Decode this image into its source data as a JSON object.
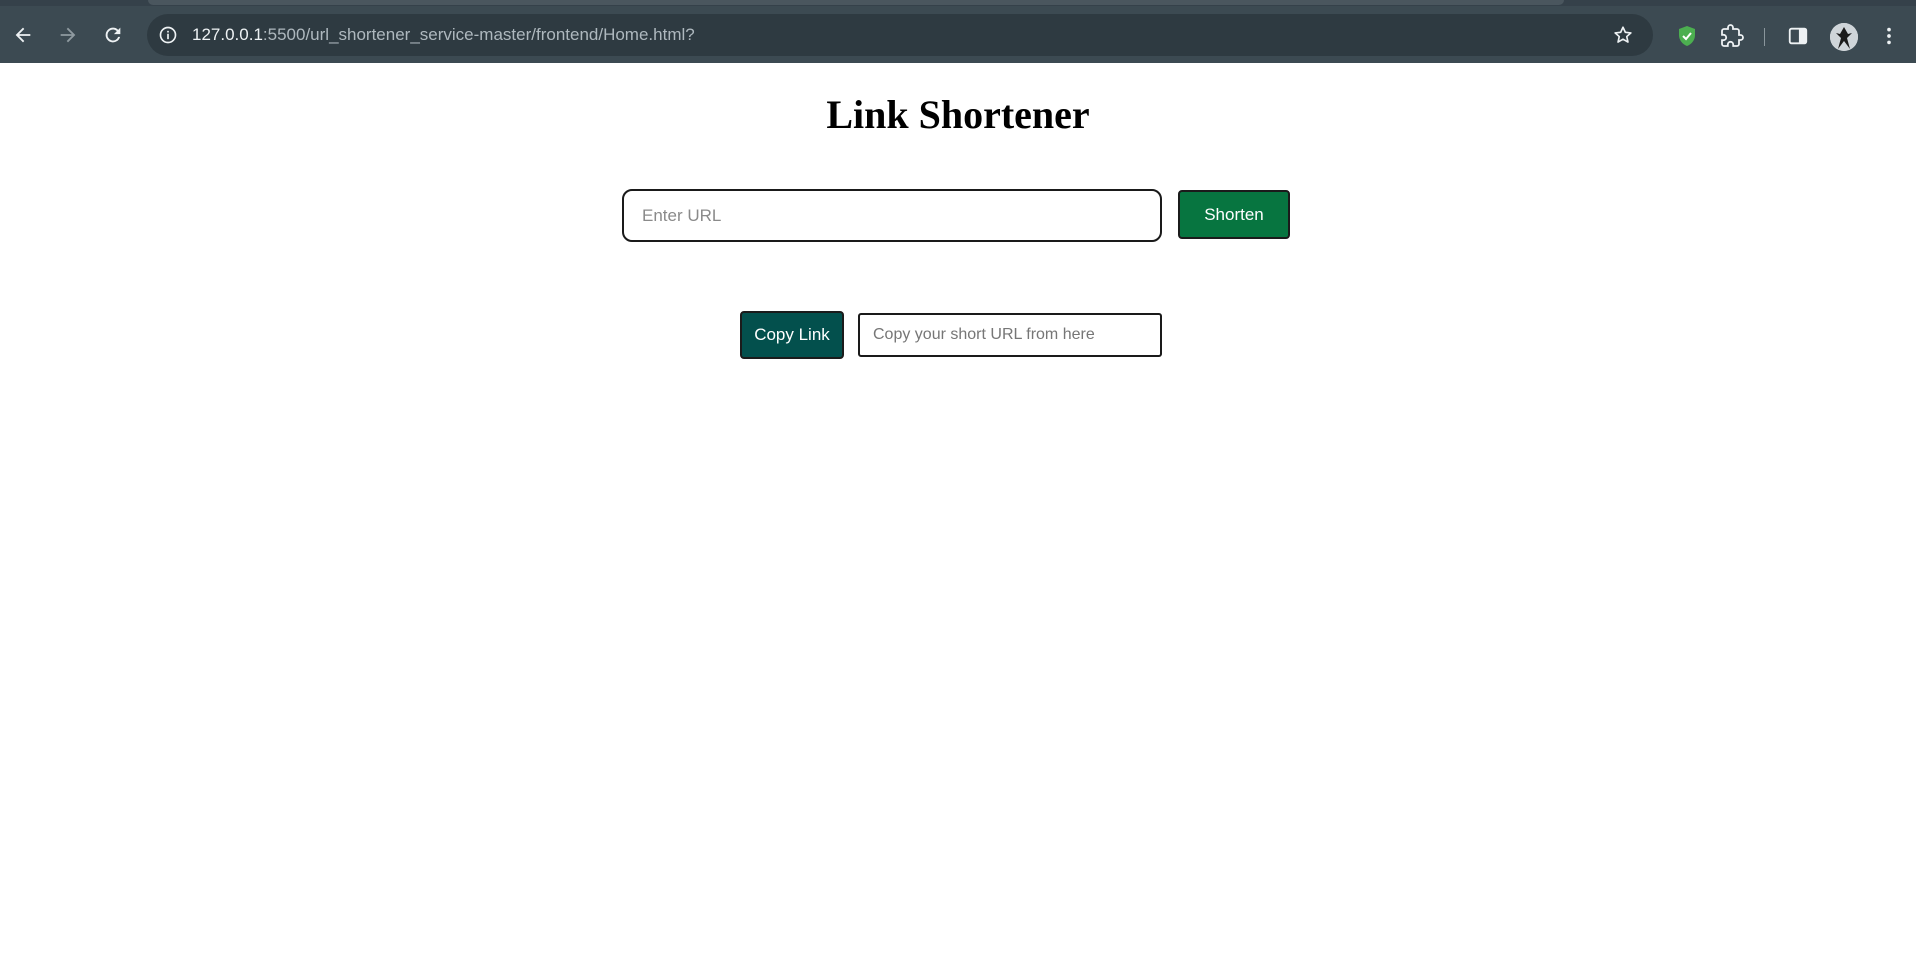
{
  "browser": {
    "url_host": "127.0.0.1",
    "url_rest": ":5500/url_shortener_service-master/frontend/Home.html?",
    "icons": [
      "back-arrow-icon",
      "forward-arrow-icon",
      "reload-icon",
      "site-info-icon",
      "bookmark-star-icon",
      "shield-extension-icon",
      "extensions-puzzle-icon",
      "side-panel-icon",
      "profile-avatar",
      "more-menu-icon"
    ],
    "colors": {
      "toolbar": "#3c4a52",
      "omnibox": "#2e3a41",
      "shield": "#4caf50"
    }
  },
  "page": {
    "title": "Link Shortener",
    "url_input": {
      "placeholder": "Enter URL",
      "value": ""
    },
    "shorten_label": "Shorten",
    "copy_label": "Copy Link",
    "short_url_input": {
      "placeholder": "Copy your short URL from here",
      "value": ""
    },
    "colors": {
      "shorten_button": "#077540",
      "copy_button": "#03504d"
    }
  }
}
